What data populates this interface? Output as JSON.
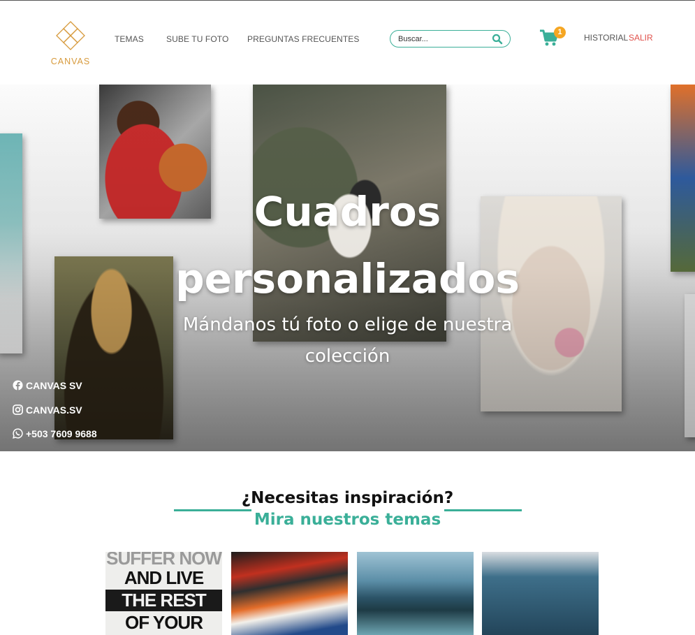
{
  "brand": {
    "name": "CANVAS"
  },
  "nav": {
    "temas": "TEMAS",
    "sube": "SUBE TU FOTO",
    "preguntas": "PREGUNTAS FRECUENTES"
  },
  "search": {
    "placeholder": "Buscar..."
  },
  "cart": {
    "count": "1"
  },
  "account": {
    "historial": "HISTORIAL",
    "salir": "SALIR"
  },
  "hero": {
    "title_line1": "Cuadros",
    "title_line2": "personalizados",
    "subtitle_line1": "Mándanos tú foto o elige de nuestra",
    "subtitle_line2": "colección"
  },
  "social": {
    "facebook": "CANVAS SV",
    "instagram": "CANVAS.SV",
    "whatsapp": "+503 7609 9688"
  },
  "inspiration": {
    "title": "¿Necesitas inspiración?",
    "subtitle": "Mira nuestros temas"
  },
  "themes": [
    {
      "poster_lines": [
        "SUFFER NOW",
        "AND LIVE",
        "THE REST",
        "OF YOUR"
      ]
    },
    {
      "poster_lines": []
    },
    {
      "poster_lines": []
    },
    {
      "poster_lines": []
    }
  ],
  "colors": {
    "accent": "#3aaf98",
    "logout": "#e0504a",
    "badge": "#f5a623",
    "logo": "#d79a3c"
  }
}
